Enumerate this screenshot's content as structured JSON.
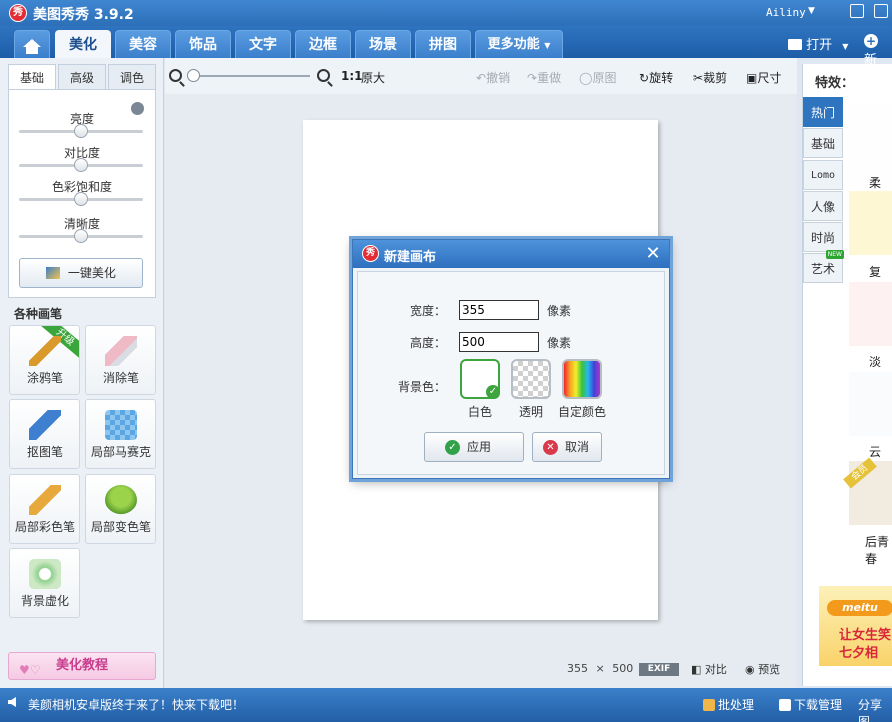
{
  "app": {
    "logo_text": "秀",
    "title": "美图秀秀 3.9.2",
    "user": "Ailiny"
  },
  "menu": {
    "tabs": [
      "美化",
      "美容",
      "饰品",
      "文字",
      "边框",
      "场景",
      "拼图"
    ],
    "more": "更多功能",
    "open": "打开",
    "new": "新"
  },
  "left": {
    "subtabs": [
      "基础",
      "高级",
      "调色"
    ],
    "sliders": [
      {
        "label": "亮度",
        "value": 0.5
      },
      {
        "label": "对比度",
        "value": 0.5
      },
      {
        "label": "色彩饱和度",
        "value": 0.5
      },
      {
        "label": "清晰度",
        "value": 0.5
      }
    ],
    "one_click": "一键美化",
    "brushes_title": "各种画笔",
    "brushes": [
      "涂鸦笔",
      "消除笔",
      "抠图笔",
      "局部马赛克",
      "局部彩色笔",
      "局部变色笔",
      "背景虚化"
    ],
    "upgrade_badge": "升级",
    "tutorial": "美化教程"
  },
  "toolbar": {
    "ratio": "1:1",
    "original_size": "原大",
    "undo": "撤销",
    "redo": "重做",
    "original": "原图",
    "rotate": "旋转",
    "crop": "裁剪",
    "size": "尺寸"
  },
  "canvas": {
    "width": "355",
    "height": "500",
    "times": "×",
    "exif": "EXIF",
    "compare": "对比",
    "preview": "预览"
  },
  "dialog": {
    "title": "新建画布",
    "width_label": "宽度：",
    "width_value": "355",
    "height_label": "高度：",
    "height_value": "500",
    "unit": "像素",
    "bg_label": "背景色：",
    "swatches": [
      "白色",
      "透明",
      "自定颜色"
    ],
    "apply": "应用",
    "cancel": "取消"
  },
  "right": {
    "title": "特效：",
    "categories": [
      "热门",
      "基础",
      "Lomo",
      "人像",
      "时尚",
      "艺术"
    ],
    "new_badge": "NEW",
    "effects": [
      "柔光",
      "复古",
      "淡雅",
      "云端",
      "后青春"
    ],
    "vip_badge": "会员",
    "ad_brand": "meitu",
    "ad_lines": [
      "让女生笑",
      "七夕相"
    ]
  },
  "status": {
    "message": "美颜相机安卓版终于来了！快来下载吧！",
    "batch": "批处理",
    "download": "下载管理",
    "share": "分享图"
  }
}
